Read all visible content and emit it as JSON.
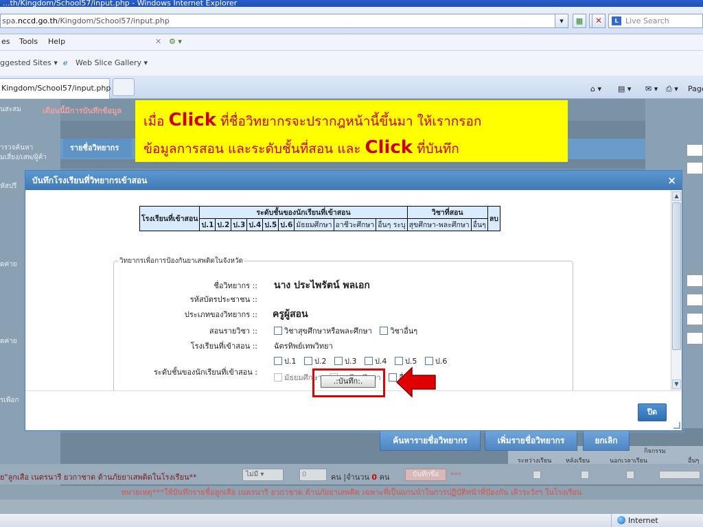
{
  "browser": {
    "title": "...th/Kingdom/School57/input.php - Windows Internet Explorer",
    "address_prefix": "spa.",
    "address_host": "nccd.go.th",
    "address_path": "/Kingdom/School57/input.php",
    "live_search_placeholder": "Live Search",
    "menu": [
      "es",
      "Tools",
      "Help"
    ],
    "favorites": [
      "ggested Sites ▾",
      "Web Slice Gallery ▾"
    ],
    "tab_label": "Kingdom/School57/input.php",
    "page_menu": "Page"
  },
  "background_page": {
    "side_items": [
      "นสะสม",
      "ารวจค้นหา",
      "มเสี่ยง/เสพ/ผู้ค้า",
      "หัสปรี",
      "ัดค่าย",
      "ัดค่าย",
      "รเพือก"
    ],
    "notice": "เดือนนี้มีการบันทึกข้อมูล",
    "panel_title": "รายชื่อวิทยากร",
    "buttons": [
      "ค้นหารายชื่อวิทยากร",
      "เพิ่มรายชื่อวิทยากร",
      "ยกเลิก"
    ],
    "table_header": [
      "ระหว่างเรียน",
      "หลังเรียน",
      "นอกเวลาเรียน",
      "อื่นๆ",
      "กิจกรรม"
    ],
    "row_label": "ย\"ลูกเสือ เนตรนารี ยวกาชาด ต้านภัยยาเสพติดในโรงเรียน**",
    "row_select": "ไม่มี",
    "row_input": "0",
    "row_text_1": "คน |จำนวน",
    "row_count": "0",
    "row_text_2": "คน",
    "row_button": "บันทึกชื่อ",
    "row_stars": "***",
    "note": "หมายเหตุ***ให้บันทึกรายชื่อลูกเสือ เนตรนารี ยวกาชาด ต้านภัยยาเสพติด เฉพาะที่เป็นแกนนำในการปฏิบัติหน้าที่ป้องกัน เฝ้าระวังฯ ในโรงเรียน"
  },
  "callout": {
    "line1_pre": "เมื่อ",
    "click_word": "Click",
    "line1_post": "ที่ชื่อวิทยากรจะปรากฎหน้านี้ขึ้นมา ให้เรากรอก",
    "line2_pre": "ข้อมูลการสอน และระดับชั้นที่สอน และ",
    "line2_post": "ที่บันทึก"
  },
  "modal": {
    "title": "บันทึกโรงเรียนที่วิทยากรเข้าสอน",
    "close_x": "×",
    "close_button": "ปิด",
    "table": {
      "col_school": "โรงเรียนที่เข้าสอน",
      "col_levels": "ระดับชั้นของนักเรียนที่เข้าสอน",
      "col_subject": "วิชาที่สอน",
      "col_delete": "ลบ",
      "levels": [
        "ป.1",
        "ป.2",
        "ป.3",
        "ป.4",
        "ป.5",
        "ป.6",
        "มัธยมศึกษา",
        "อาชีวะศึกษา",
        "อื่นๆ ระบุ"
      ],
      "subjects": [
        "สุขศึกษา-พละศึกษา",
        "อื่นๆ"
      ]
    },
    "fieldset_legend": "วิทยากรเพื่อการป้องกันยาเสพติดในจังหวัด",
    "fields": {
      "name_label": "ชื่อวิทยากร ::",
      "name_value": "นาง  ประไพรัตน์ พลเอก",
      "id_label": "รหัสบัตรประชาชน ::",
      "type_label": "ประเภทของวิทยากร ::",
      "type_value": "ครูผู้สอน",
      "subject_label": "สอนรายวิชา ::",
      "subject_opt1": "วิชาสุขศึกษาหรือพละศึกษา",
      "subject_opt2": "วิชาอื่นๆ",
      "school_label": "โรงเรียนที่เข้าสอน ::",
      "school_value": "ฉัตรทิพย์เทพวิทยา",
      "level_label": "ระดับชั้นของนักเรียนที่เข้าสอน :",
      "level_opts_row1": [
        "ป.1",
        "ป.2",
        "ป.3",
        "ป.4",
        "ป.5",
        "ป.6"
      ],
      "level_opts_row2": [
        "มัธยมศึกษา",
        "อาชีวะศึกษา",
        "อื่นๆ"
      ]
    },
    "save_button": ".:บันทึก:."
  },
  "status": {
    "zone": "Internet"
  },
  "colors": {
    "callout_bg": "#ffff00",
    "callout_text": "#cc0000",
    "highlight": "#e00000",
    "modal_title": "#3e79b6"
  }
}
